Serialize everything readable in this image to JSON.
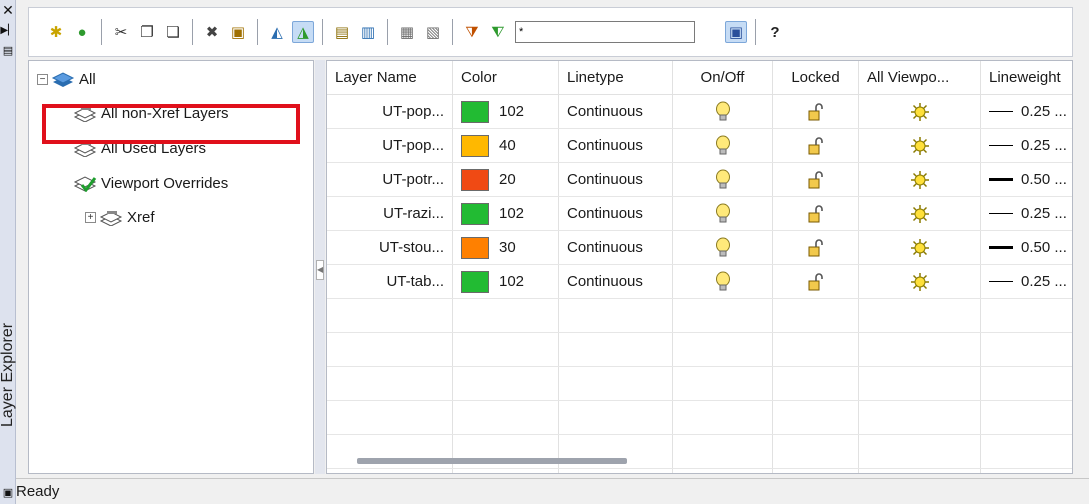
{
  "panel": {
    "title": "Layer Explorer"
  },
  "toolbar": {
    "filter_value": "*",
    "buttons": [
      {
        "name": "new-layer-icon",
        "glyph": "✱",
        "color": "#c9a400"
      },
      {
        "name": "set-current-icon",
        "glyph": "●",
        "color": "#2e9a2e"
      },
      {
        "name": "cut-icon",
        "glyph": "✂",
        "color": "#333333"
      },
      {
        "name": "copy-icon",
        "glyph": "❐",
        "color": "#333333"
      },
      {
        "name": "paste-icon",
        "glyph": "❏",
        "color": "#333333"
      },
      {
        "name": "delete-icon",
        "glyph": "✖",
        "color": "#444444"
      },
      {
        "name": "properties-icon",
        "glyph": "▣",
        "color": "#a07000"
      },
      {
        "name": "freeze-viewport-icon",
        "glyph": "◭",
        "color": "#2a6db0"
      },
      {
        "name": "new-vp-freeze-icon",
        "glyph": "◮",
        "color": "#2e9a2e"
      },
      {
        "name": "new-property-filter-icon",
        "glyph": "▤",
        "color": "#8a6b00"
      },
      {
        "name": "new-group-filter-icon",
        "glyph": "▥",
        "color": "#2a6db0"
      },
      {
        "name": "layer-states-icon",
        "glyph": "▦",
        "color": "#6b6b6b"
      },
      {
        "name": "layer-translate-icon",
        "glyph": "▧",
        "color": "#6b6b6b"
      },
      {
        "name": "filter-icon",
        "glyph": "⧩",
        "color": "#c05000"
      },
      {
        "name": "invert-filter-icon",
        "glyph": "⧨",
        "color": "#2e9a2e"
      },
      {
        "name": "settings-panel-icon",
        "glyph": "▣",
        "color": "#2a4f9b"
      },
      {
        "name": "help-icon",
        "glyph": "?",
        "color": "#222222"
      }
    ]
  },
  "tree": {
    "root": "All",
    "items": [
      {
        "label": "All non-Xref Layers"
      },
      {
        "label": "All Used Layers"
      },
      {
        "label": "Viewport Overrides"
      },
      {
        "label": "Xref"
      }
    ]
  },
  "grid": {
    "columns": [
      "Layer Name",
      "Color",
      "Linetype",
      "On/Off",
      "Locked",
      "All Viewpo...",
      "Lineweight"
    ],
    "rows": [
      {
        "name": "UT-pop...",
        "color_hex": "#22bb33",
        "color_num": "102",
        "linetype": "Continuous",
        "lineweight": "0.25 ..."
      },
      {
        "name": "UT-pop...",
        "color_hex": "#ffb800",
        "color_num": "40",
        "linetype": "Continuous",
        "lineweight": "0.25 ..."
      },
      {
        "name": "UT-potr...",
        "color_hex": "#f04a14",
        "color_num": "20",
        "linetype": "Continuous",
        "lineweight": "0.50 ..."
      },
      {
        "name": "UT-razi...",
        "color_hex": "#22bb33",
        "color_num": "102",
        "linetype": "Continuous",
        "lineweight": "0.25 ..."
      },
      {
        "name": "UT-stou...",
        "color_hex": "#ff8000",
        "color_num": "30",
        "linetype": "Continuous",
        "lineweight": "0.50 ..."
      },
      {
        "name": "UT-tab...",
        "color_hex": "#22bb33",
        "color_num": "102",
        "linetype": "Continuous",
        "lineweight": "0.25 ..."
      }
    ]
  },
  "status": {
    "text": "Ready"
  }
}
